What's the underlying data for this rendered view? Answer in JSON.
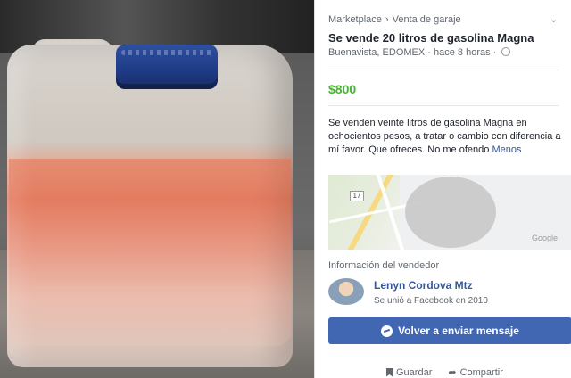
{
  "colors": {
    "price": "#42b72a",
    "link": "#365899",
    "button_bg": "#4267b2",
    "button_text": "#ffffff",
    "text_primary": "#1d2129",
    "text_secondary": "#606770"
  },
  "breadcrumbs": [
    "Marketplace",
    "Venta de garaje"
  ],
  "listing": {
    "title": "Se vende 20 litros de gasolina Magna",
    "location": "Buenavista, EDOMEX",
    "time": "hace 8 horas",
    "price": "$800",
    "description": "Se venden veinte litros de gasolina Magna en ochocientos pesos, a tratar o cambio con diferencia a mí favor. Que ofreces. No me ofendo",
    "less_link": "Menos"
  },
  "map": {
    "road_shield": "17",
    "brand": "Google"
  },
  "seller": {
    "section_title": "Información del vendedor",
    "name": "Lenyn Cordova Mtz",
    "joined": "Se unió a Facebook en 2010"
  },
  "buttons": {
    "message": "Volver a enviar mensaje",
    "save": "Guardar",
    "share": "Compartir"
  },
  "icons": [
    "chevron-down-icon",
    "globe-icon",
    "messenger-icon",
    "bookmark-icon",
    "share-icon"
  ]
}
